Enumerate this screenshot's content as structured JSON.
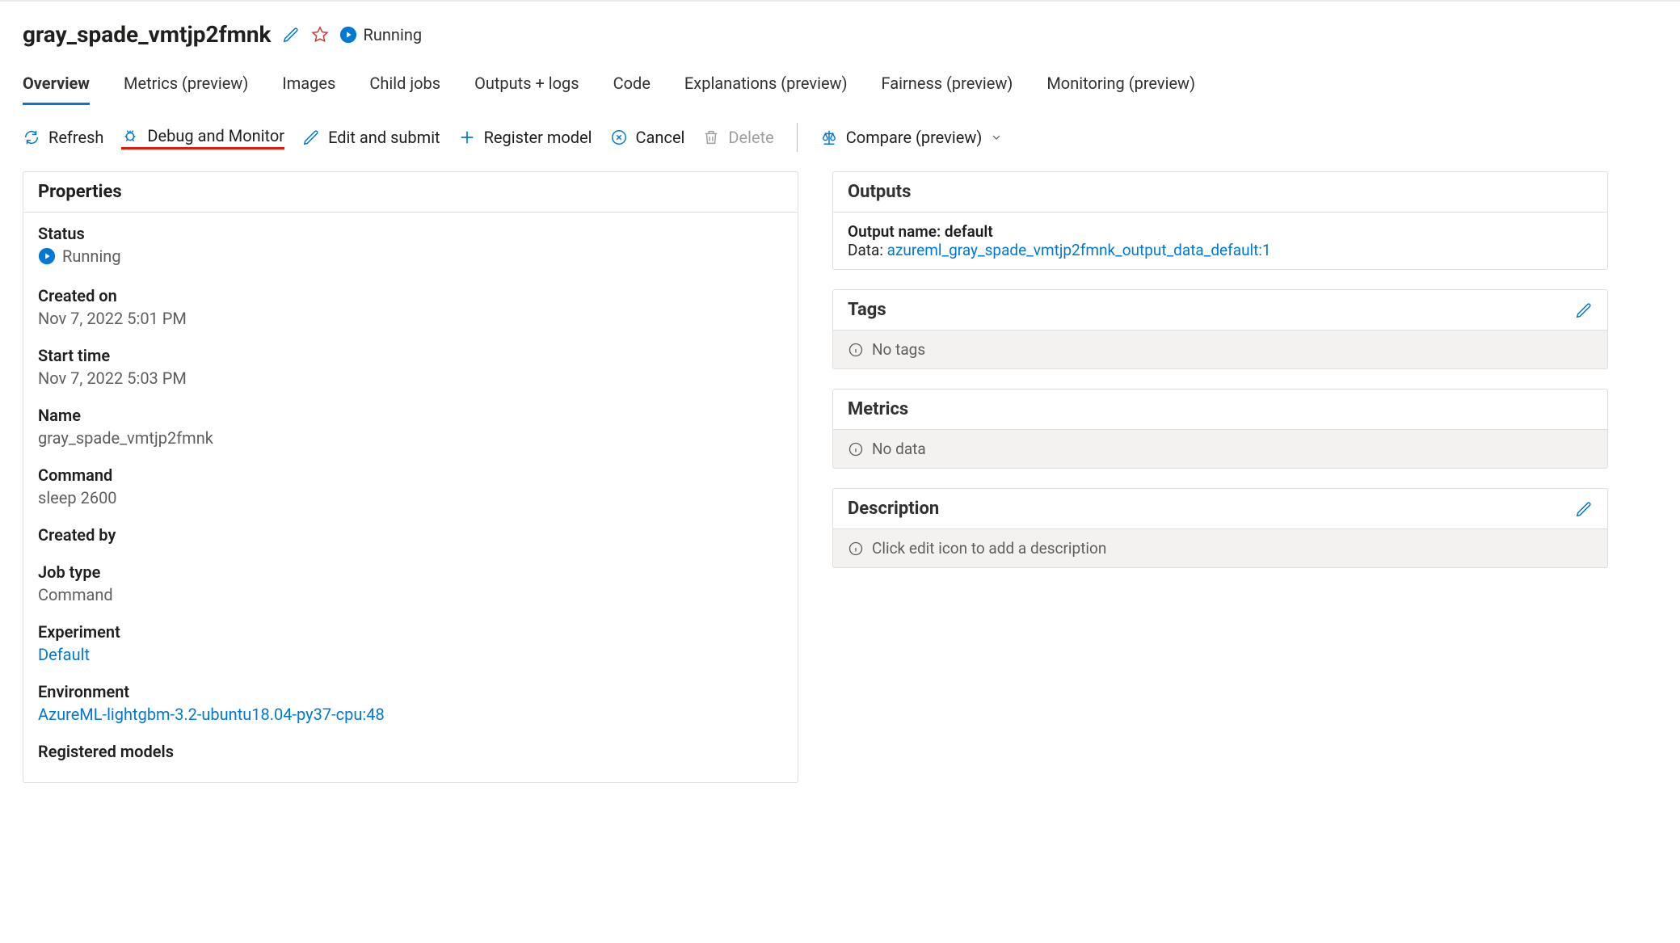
{
  "header": {
    "title": "gray_spade_vmtjp2fmnk",
    "status_label": "Running"
  },
  "tabs": [
    {
      "label": "Overview",
      "active": true
    },
    {
      "label": "Metrics (preview)"
    },
    {
      "label": "Images"
    },
    {
      "label": "Child jobs"
    },
    {
      "label": "Outputs + logs"
    },
    {
      "label": "Code"
    },
    {
      "label": "Explanations (preview)"
    },
    {
      "label": "Fairness (preview)"
    },
    {
      "label": "Monitoring (preview)"
    }
  ],
  "toolbar": {
    "refresh": "Refresh",
    "debug": "Debug and Monitor",
    "edit": "Edit and submit",
    "register": "Register model",
    "cancel": "Cancel",
    "delete": "Delete",
    "compare": "Compare (preview)"
  },
  "properties": {
    "title": "Properties",
    "status_label": "Status",
    "status_value": "Running",
    "created_on_label": "Created on",
    "created_on_value": "Nov 7, 2022 5:01 PM",
    "start_time_label": "Start time",
    "start_time_value": "Nov 7, 2022 5:03 PM",
    "name_label": "Name",
    "name_value": "gray_spade_vmtjp2fmnk",
    "command_label": "Command",
    "command_value": "sleep 2600",
    "created_by_label": "Created by",
    "created_by_value": "",
    "job_type_label": "Job type",
    "job_type_value": "Command",
    "experiment_label": "Experiment",
    "experiment_value": "Default",
    "environment_label": "Environment",
    "environment_value": "AzureML-lightgbm-3.2-ubuntu18.04-py37-cpu:48",
    "registered_models_label": "Registered models"
  },
  "outputs": {
    "title": "Outputs",
    "name_label": "Output name: default",
    "data_prefix": "Data: ",
    "data_link": "azureml_gray_spade_vmtjp2fmnk_output_data_default:1"
  },
  "tags": {
    "title": "Tags",
    "empty": "No tags"
  },
  "metrics": {
    "title": "Metrics",
    "empty": "No data"
  },
  "description": {
    "title": "Description",
    "empty": "Click edit icon to add a description"
  }
}
